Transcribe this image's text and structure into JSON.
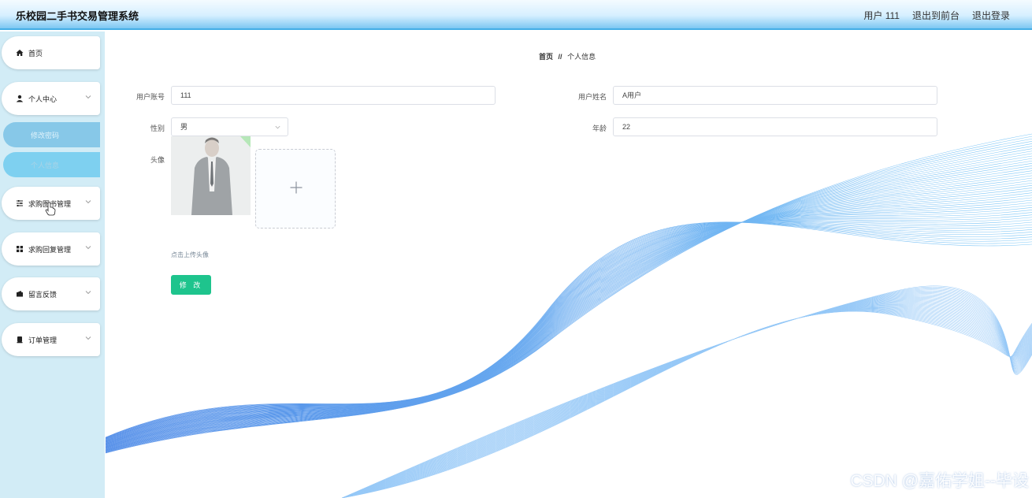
{
  "header": {
    "title": "乐校园二手书交易管理系统",
    "user": "用户 111",
    "to_front": "退出到前台",
    "logout": "退出登录"
  },
  "sidebar": {
    "items": [
      {
        "label": "首页",
        "icon": "home-icon"
      },
      {
        "label": "个人中心",
        "icon": "user-icon"
      },
      {
        "label": "求购图书管理",
        "icon": "list-icon"
      },
      {
        "label": "求购回复管理",
        "icon": "grid-icon"
      },
      {
        "label": "留言反馈",
        "icon": "wallet-icon"
      },
      {
        "label": "订单管理",
        "icon": "order-icon"
      }
    ],
    "sub_items": [
      {
        "label": "修改密码"
      },
      {
        "label": "个人信息"
      }
    ]
  },
  "breadcrumb": {
    "home": "首页",
    "separator": "//",
    "current": "个人信息"
  },
  "form": {
    "account_label": "用户账号",
    "account_value": "111",
    "name_label": "用户姓名",
    "name_value": "A用户",
    "gender_label": "性别",
    "gender_value": "男",
    "age_label": "年龄",
    "age_value": "22",
    "avatar_label": "头像",
    "upload_hint": "点击上传头像",
    "submit": "修 改"
  },
  "watermark": "CSDN @嘉佑学姐--毕设",
  "colors": {
    "header_accent": "#43aee6",
    "sidebar_bg": "#d2ecf6",
    "primary_button": "#1ec48d",
    "wave_blue": "#1e7fe6"
  }
}
